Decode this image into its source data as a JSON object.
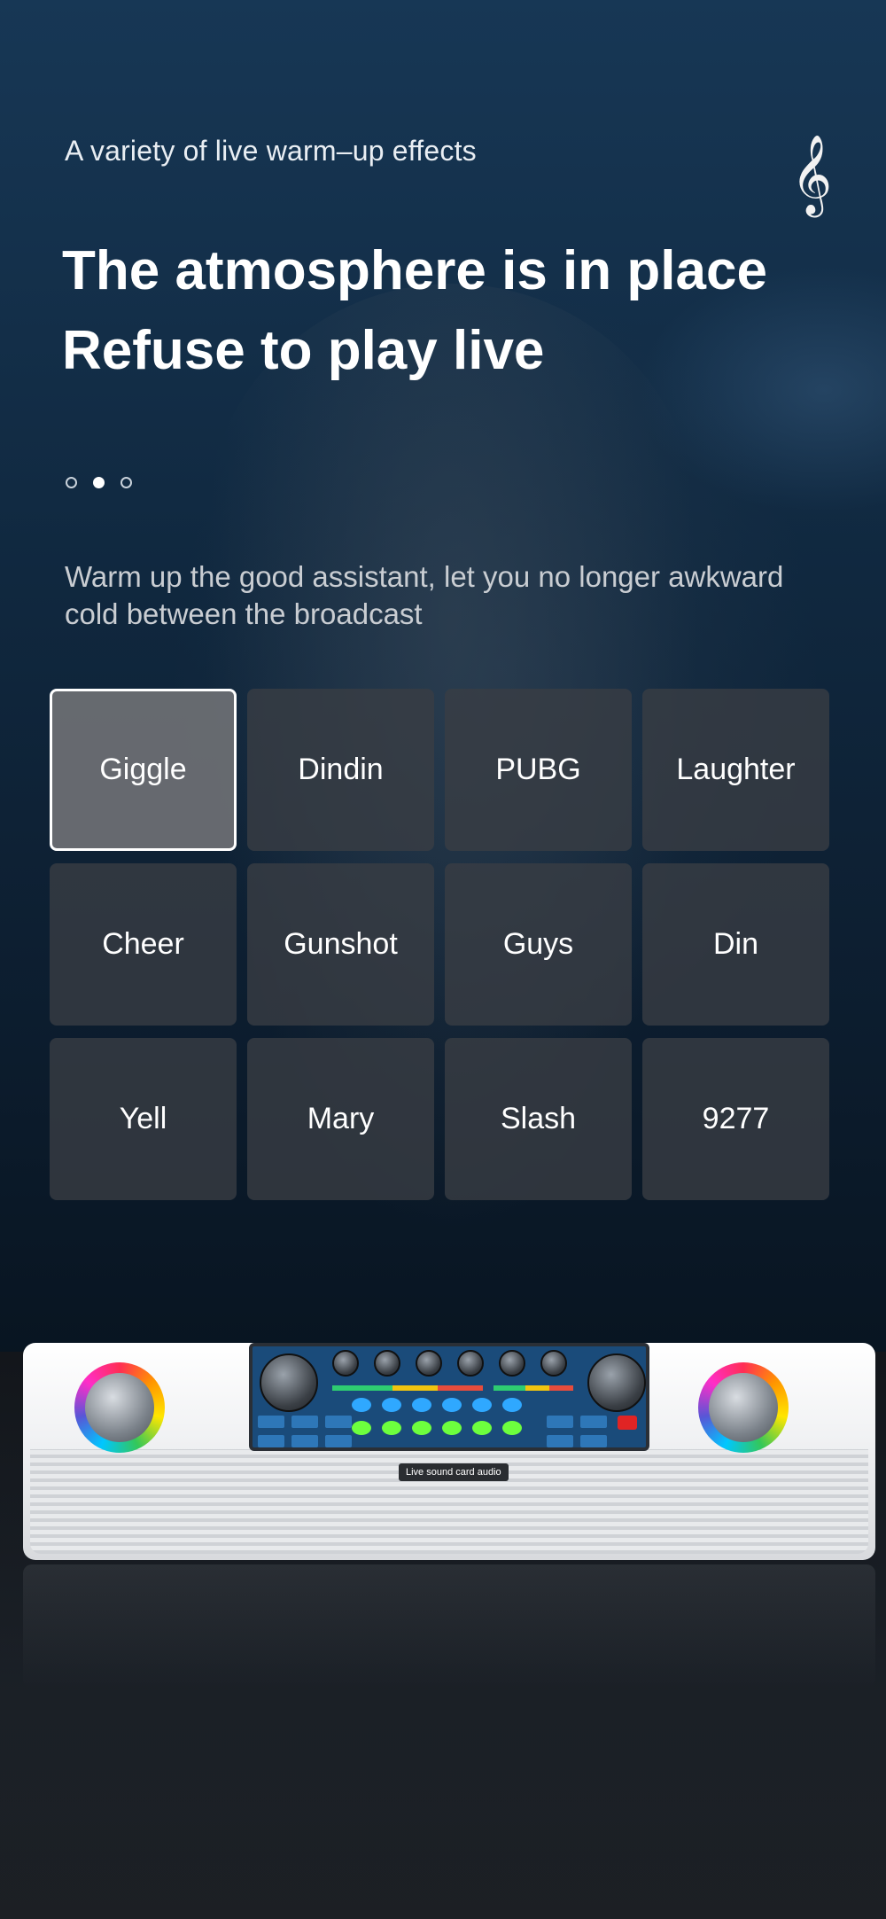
{
  "header": {
    "subtitle": "A variety of live warm–up effects",
    "clef_icon": "treble-clef-icon",
    "headline_line1": "The atmosphere is in place",
    "headline_line2": "Refuse to play live"
  },
  "carousel": {
    "dot_count": 3,
    "active_index": 1
  },
  "description": "Warm up the good assistant, let you no longer awkward cold between the broadcast",
  "effects": [
    {
      "label": "Giggle",
      "selected": true
    },
    {
      "label": "Dindin",
      "selected": false
    },
    {
      "label": "PUBG",
      "selected": false
    },
    {
      "label": "Laughter",
      "selected": false
    },
    {
      "label": "Cheer",
      "selected": false
    },
    {
      "label": "Gunshot",
      "selected": false
    },
    {
      "label": "Guys",
      "selected": false
    },
    {
      "label": "Din",
      "selected": false
    },
    {
      "label": "Yell",
      "selected": false
    },
    {
      "label": "Mary",
      "selected": false
    },
    {
      "label": "Slash",
      "selected": false
    },
    {
      "label": "9277",
      "selected": false
    }
  ],
  "device": {
    "badge": "Live sound card audio"
  },
  "colors": {
    "pad_selected_border": "#ffffff",
    "button_green": "#6dff3e",
    "panel_blue": "#1a4b7a"
  }
}
